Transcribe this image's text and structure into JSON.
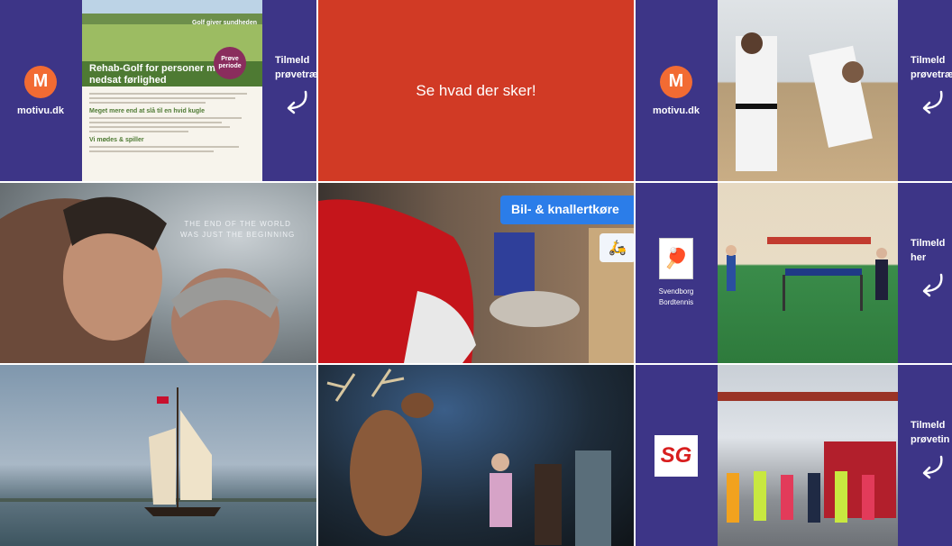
{
  "tiles": {
    "rehab_golf": {
      "brand": "motivu.dk",
      "cta_lines": [
        "Tilmeld",
        "prøvetræn"
      ],
      "flyer_title": "Rehab-Golf for personer med nedsat førlighed",
      "flyer_badge": "Prøve periode",
      "flyer_side": "Golf giver sundheden",
      "flyer_section1": "Meget mere end at slå til en hvid kugle",
      "flyer_section2": "Vi mødes & spiller"
    },
    "promo": {
      "text": "Se hvad der sker!"
    },
    "taekwondo": {
      "brand": "motivu.dk",
      "cta_lines": [
        "Tilmeld",
        "prøvetræn"
      ]
    },
    "movie": {
      "tagline_lines": [
        "THE END OF THE WORLD",
        "WAS JUST THE BEGINNING"
      ]
    },
    "accident": {
      "tag": "Bil- & knallertkøre"
    },
    "table_tennis": {
      "club_name_lines": [
        "Svendborg",
        "Bordtennis"
      ],
      "cta_lines": [
        "Tilmeld",
        "her"
      ]
    },
    "ship": {},
    "museum": {},
    "sg": {
      "logo_text": "SG",
      "cta_lines": [
        "Tilmeld",
        "prøvetin"
      ]
    }
  },
  "colors": {
    "purple": "#3d3587",
    "orange": "#f26b33",
    "red": "#d13a25",
    "blue": "#2b7de9"
  }
}
